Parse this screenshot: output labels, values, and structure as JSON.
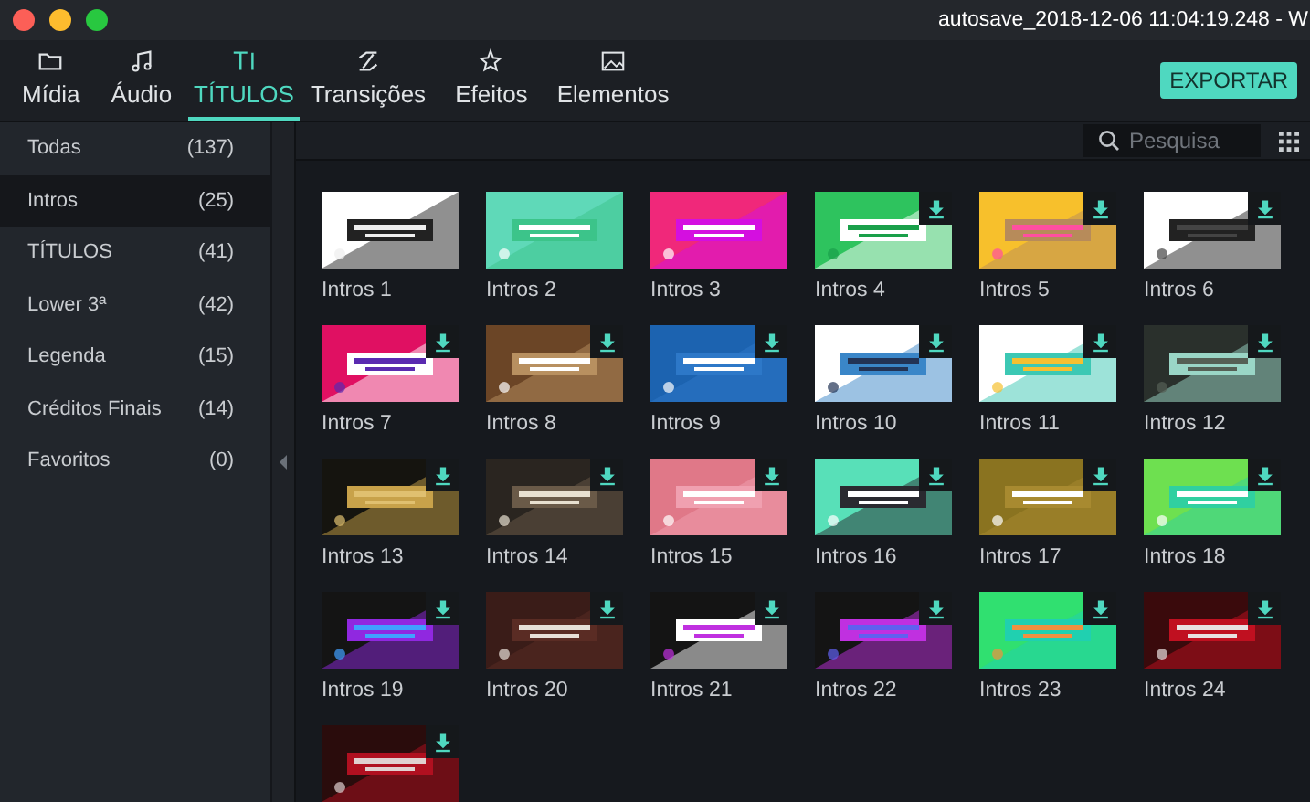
{
  "window": {
    "title": "autosave_2018-12-06 11:04:19.248 - W"
  },
  "tabs": [
    {
      "label": "Mídia",
      "selected": false
    },
    {
      "label": "Áudio",
      "selected": false
    },
    {
      "label": "TÍTULOS",
      "selected": true
    },
    {
      "label": "Transições",
      "selected": false
    },
    {
      "label": "Efeitos",
      "selected": false
    },
    {
      "label": "Elementos",
      "selected": false
    }
  ],
  "export_button": "EXPORTAR",
  "sidebar": {
    "items": [
      {
        "label": "Todas",
        "count": "(137)",
        "selected": false
      },
      {
        "label": "Intros",
        "count": "(25)",
        "selected": true
      },
      {
        "label": "TÍTULOS",
        "count": "(41)",
        "selected": false
      },
      {
        "label": "Lower 3ª",
        "count": "(42)",
        "selected": false
      },
      {
        "label": "Legenda",
        "count": "(15)",
        "selected": false
      },
      {
        "label": "Créditos Finais",
        "count": "(14)",
        "selected": false
      },
      {
        "label": "Favoritos",
        "count": "(0)",
        "selected": false
      }
    ]
  },
  "search": {
    "placeholder": "Pesquisa"
  },
  "templates": [
    {
      "label": "Intros 1",
      "downloadable": false
    },
    {
      "label": "Intros 2",
      "downloadable": false
    },
    {
      "label": "Intros 3",
      "downloadable": false
    },
    {
      "label": "Intros 4",
      "downloadable": true
    },
    {
      "label": "Intros 5",
      "downloadable": true
    },
    {
      "label": "Intros 6",
      "downloadable": true
    },
    {
      "label": "Intros 7",
      "downloadable": true
    },
    {
      "label": "Intros 8",
      "downloadable": true
    },
    {
      "label": "Intros 9",
      "downloadable": true
    },
    {
      "label": "Intros 10",
      "downloadable": true
    },
    {
      "label": "Intros 11",
      "downloadable": true
    },
    {
      "label": "Intros 12",
      "downloadable": true
    },
    {
      "label": "Intros 13",
      "downloadable": true
    },
    {
      "label": "Intros 14",
      "downloadable": true
    },
    {
      "label": "Intros 15",
      "downloadable": true
    },
    {
      "label": "Intros 16",
      "downloadable": true
    },
    {
      "label": "Intros 17",
      "downloadable": true
    },
    {
      "label": "Intros 18",
      "downloadable": true
    },
    {
      "label": "Intros 19",
      "downloadable": true
    },
    {
      "label": "Intros 20",
      "downloadable": true
    },
    {
      "label": "Intros 21",
      "downloadable": true
    },
    {
      "label": "Intros 22",
      "downloadable": true
    },
    {
      "label": "Intros 23",
      "downloadable": true
    },
    {
      "label": "Intros 24",
      "downloadable": true
    },
    {
      "downloadable": true
    }
  ]
}
